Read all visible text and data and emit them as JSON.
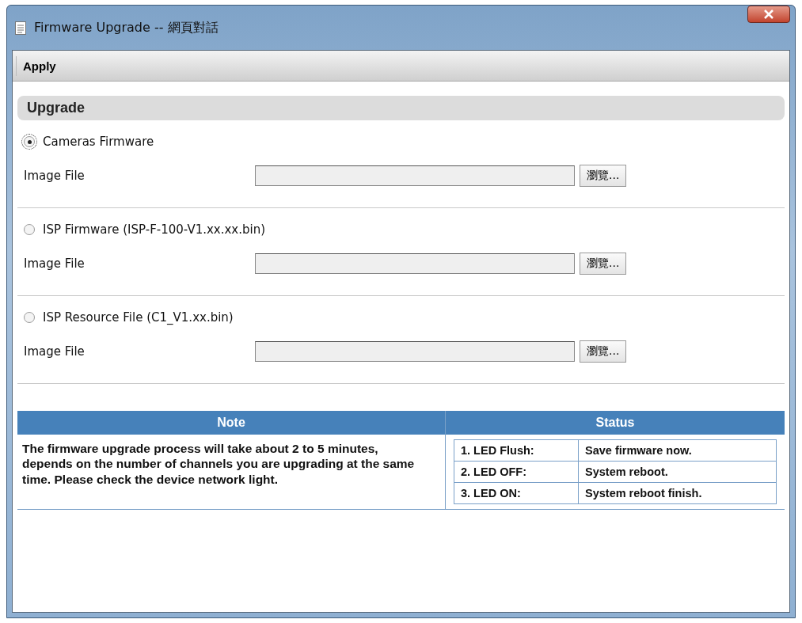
{
  "window": {
    "title": "Firmware Upgrade -- 網頁對話"
  },
  "toolbar": {
    "apply": "Apply"
  },
  "section": {
    "title": "Upgrade"
  },
  "options": [
    {
      "label": "Cameras Firmware",
      "selected": true,
      "field_label": "Image File",
      "browse": "瀏覽..."
    },
    {
      "label": "ISP Firmware (ISP-F-100-V1.xx.xx.bin)",
      "selected": false,
      "field_label": "Image File",
      "browse": "瀏覽..."
    },
    {
      "label": "ISP Resource File (C1_V1.xx.bin)",
      "selected": false,
      "field_label": "Image File",
      "browse": "瀏覽..."
    }
  ],
  "note": {
    "heading": "Note",
    "text": "The firmware upgrade process will take about 2 to 5 minutes, depends on the number of channels you are upgrading at the same time. Please check the device network light."
  },
  "status": {
    "heading": "Status",
    "rows": [
      {
        "led": "1. LED Flush:",
        "meaning": "Save firmware now."
      },
      {
        "led": "2. LED OFF:",
        "meaning": "System reboot."
      },
      {
        "led": "3. LED ON:",
        "meaning": "System reboot finish."
      }
    ]
  }
}
